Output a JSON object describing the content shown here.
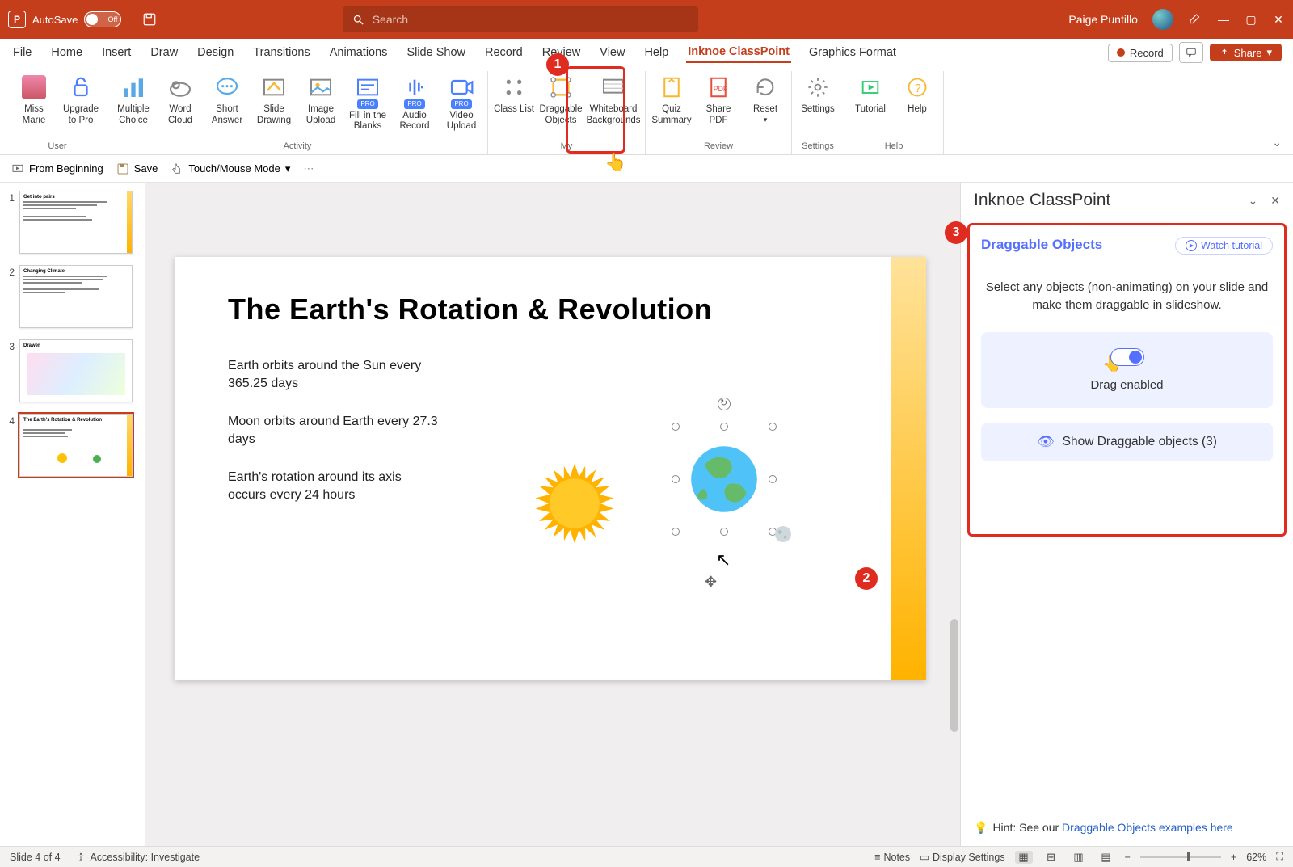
{
  "titlebar": {
    "autosave_label": "AutoSave",
    "autosave_state": "Off",
    "search_placeholder": "Search",
    "user_name": "Paige Puntillo"
  },
  "menutabs": [
    "File",
    "Home",
    "Insert",
    "Draw",
    "Design",
    "Transitions",
    "Animations",
    "Slide Show",
    "Record",
    "Review",
    "View",
    "Help",
    "Inknoe ClassPoint",
    "Graphics Format"
  ],
  "menutabs_active_index": 12,
  "menubar_right": {
    "record": "Record",
    "share": "Share"
  },
  "ribbon": {
    "groups": [
      {
        "label": "User",
        "items": [
          {
            "label": "Miss Marie"
          },
          {
            "label": "Upgrade to Pro"
          }
        ]
      },
      {
        "label": "Activity",
        "items": [
          {
            "label": "Multiple Choice"
          },
          {
            "label": "Word Cloud"
          },
          {
            "label": "Short Answer"
          },
          {
            "label": "Slide Drawing"
          },
          {
            "label": "Image Upload"
          },
          {
            "label": "Fill in the Blanks",
            "pro": true
          },
          {
            "label": "Audio Record",
            "pro": true
          },
          {
            "label": "Video Upload",
            "pro": true
          }
        ]
      },
      {
        "label": "My",
        "items": [
          {
            "label": "Class List"
          },
          {
            "label": "Draggable Objects"
          },
          {
            "label": "Whiteboard Backgrounds"
          }
        ]
      },
      {
        "label": "Review",
        "items": [
          {
            "label": "Quiz Summary"
          },
          {
            "label": "Share PDF"
          },
          {
            "label": "Reset"
          }
        ]
      },
      {
        "label": "Settings",
        "items": [
          {
            "label": "Settings"
          }
        ]
      },
      {
        "label": "Help",
        "items": [
          {
            "label": "Tutorial"
          },
          {
            "label": "Help"
          }
        ]
      }
    ]
  },
  "quickbar": {
    "from_beginning": "From Beginning",
    "save": "Save",
    "touch": "Touch/Mouse Mode"
  },
  "thumbs": [
    {
      "title": "Get into pairs"
    },
    {
      "title": "Changing Climate"
    },
    {
      "title": "Drawer"
    },
    {
      "title": "The Earth's Rotation & Revolution"
    }
  ],
  "thumbs_selected_index": 3,
  "slide": {
    "title": "The Earth's Rotation & Revolution",
    "p1": "Earth orbits around the Sun every 365.25 days",
    "p2": "Moon orbits around Earth every 27.3 days",
    "p3": "Earth's rotation around its axis occurs every 24 hours"
  },
  "callouts": {
    "c1": "1",
    "c2": "2",
    "c3": "3"
  },
  "panel": {
    "header": "Inknoe ClassPoint",
    "title": "Draggable Objects",
    "watch": "Watch tutorial",
    "desc": "Select any objects (non-animating) on your slide and make them draggable in slideshow.",
    "drag_enabled": "Drag enabled",
    "show": "Show Draggable objects (3)",
    "hint_pre": "Hint: See our ",
    "hint_link": "Draggable Objects examples here"
  },
  "status": {
    "slide_of": "Slide 4 of 4",
    "accessibility": "Accessibility: Investigate",
    "notes": "Notes",
    "display": "Display Settings",
    "zoom": "62%"
  }
}
